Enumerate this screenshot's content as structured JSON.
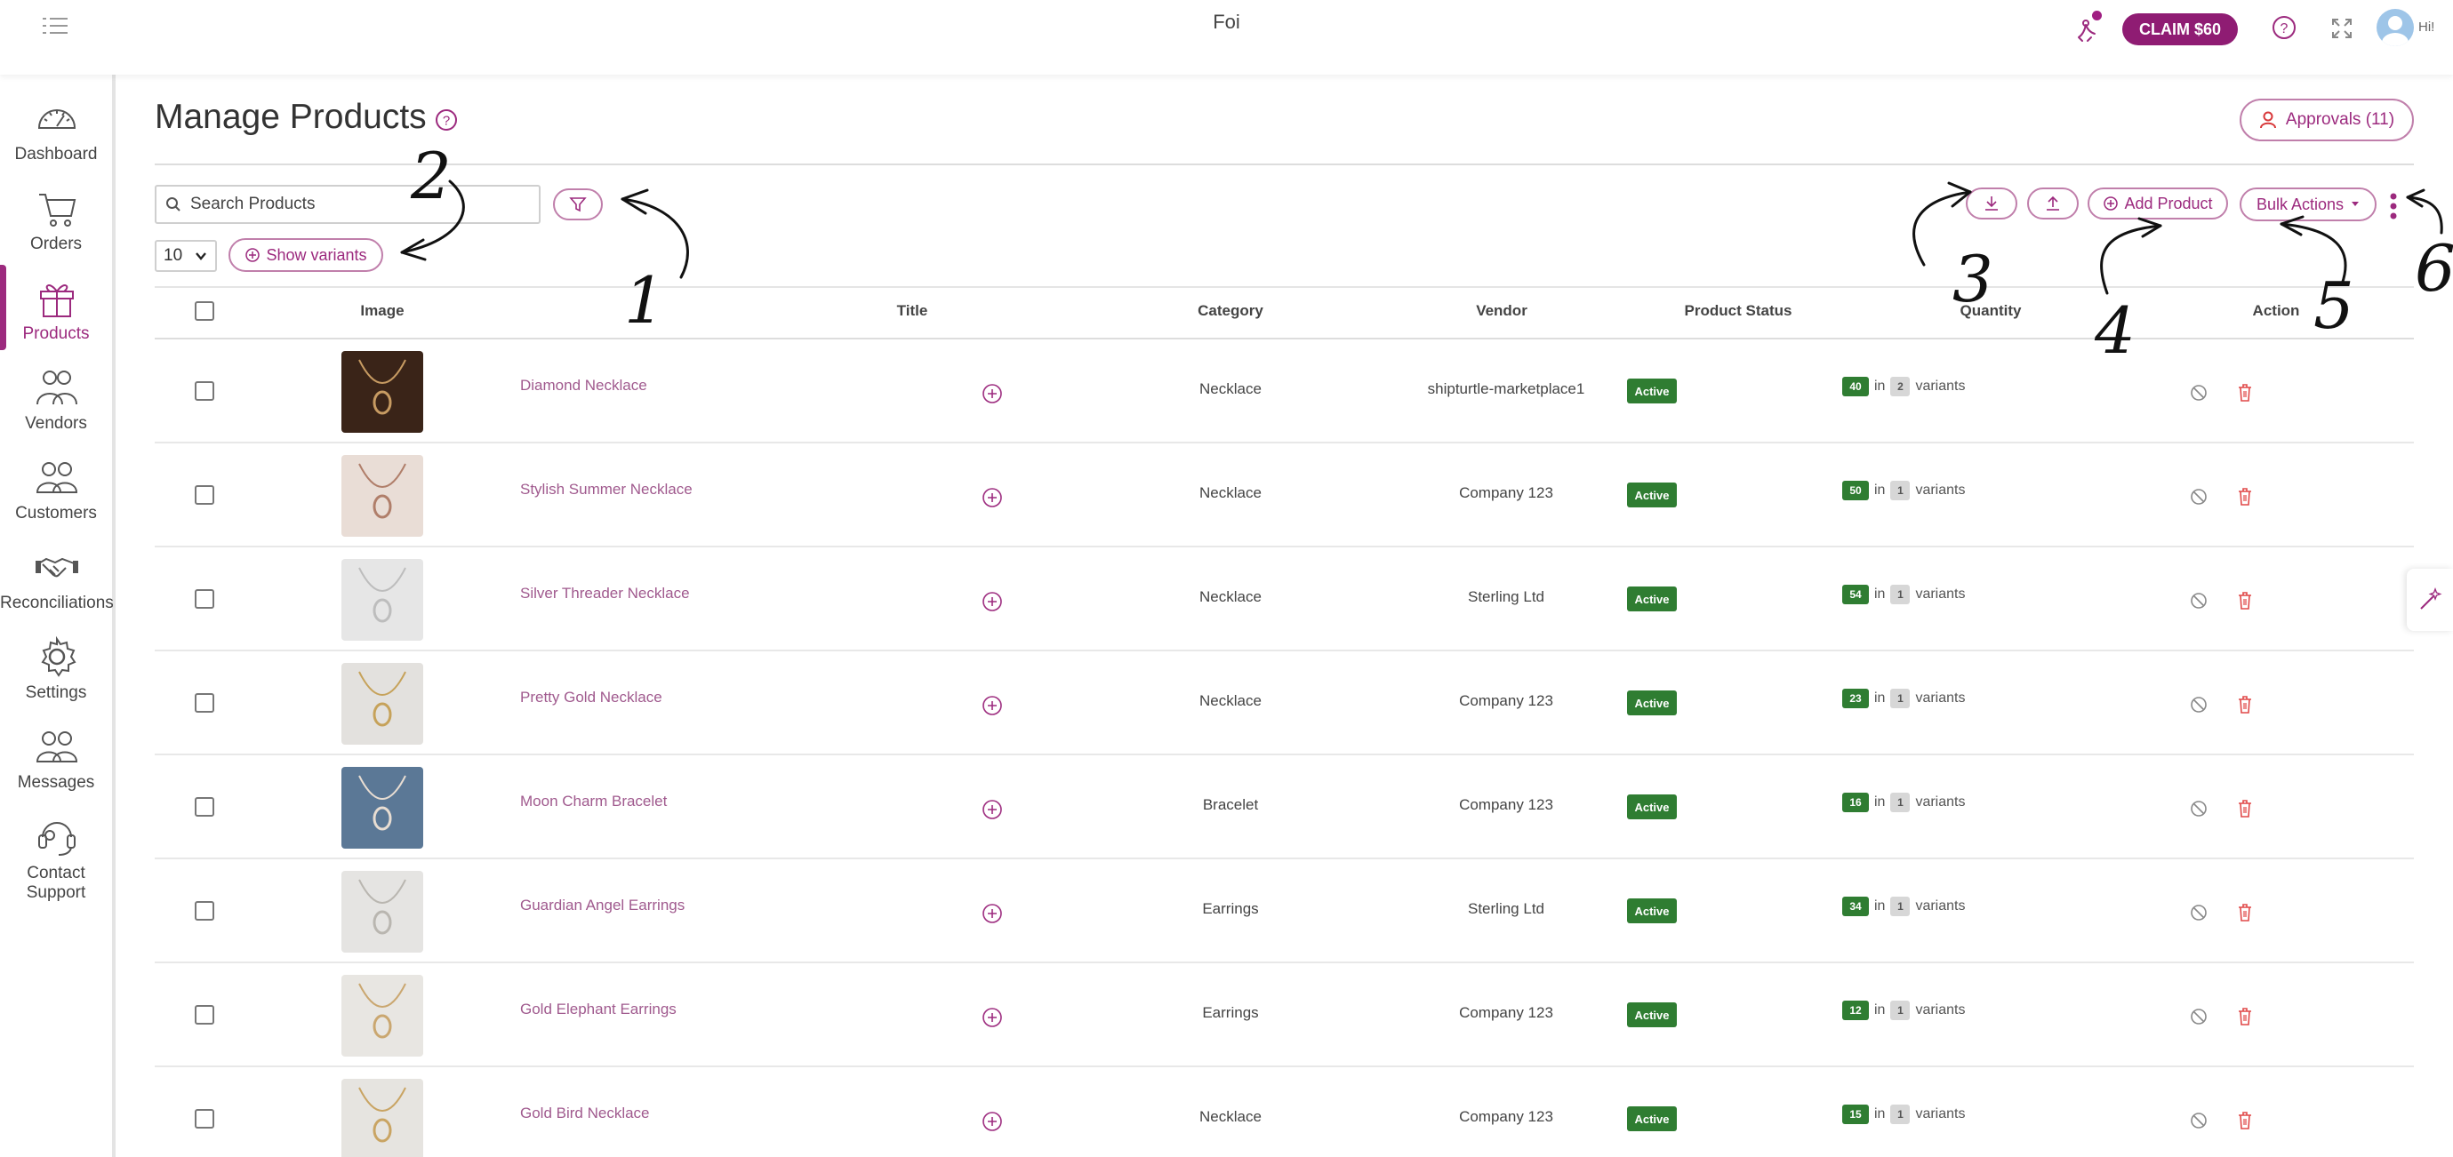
{
  "topbar": {
    "app_title": "Foi",
    "claim_label": "CLAIM $60",
    "user_greeting": "Hi!",
    "icons": [
      "menu-toggle-icon",
      "notification-icon",
      "help-icon",
      "fullscreen-icon",
      "avatar"
    ]
  },
  "sidebar": {
    "items": [
      {
        "label": "Dashboard",
        "icon": "speedometer-icon",
        "active": false
      },
      {
        "label": "Orders",
        "icon": "cart-icon",
        "active": false
      },
      {
        "label": "Products",
        "icon": "gift-icon",
        "active": true
      },
      {
        "label": "Vendors",
        "icon": "vendors-group-icon",
        "active": false
      },
      {
        "label": "Customers",
        "icon": "customers-group-icon",
        "active": false
      },
      {
        "label": "Reconciliations",
        "icon": "handshake-icon",
        "active": false
      },
      {
        "label": "Settings",
        "icon": "gear-icon",
        "active": false
      },
      {
        "label": "Messages",
        "icon": "messages-group-icon",
        "active": false
      },
      {
        "label": "Contact Support",
        "label_line1": "Contact",
        "label_line2": "Support",
        "icon": "headset-icon",
        "active": false
      }
    ]
  },
  "page": {
    "title": "Manage Products",
    "approvals_label": "Approvals (11)"
  },
  "toolbar": {
    "search_placeholder": "Search Products",
    "page_size": "10",
    "show_variants_label": "Show variants",
    "add_product_label": "Add Product",
    "bulk_actions_label": "Bulk Actions"
  },
  "table": {
    "columns": {
      "image": "Image",
      "title": "Title",
      "category": "Category",
      "vendor": "Vendor",
      "status": "Product Status",
      "quantity": "Quantity",
      "action": "Action"
    },
    "in_word": "in",
    "variants_word": "variants",
    "rows": [
      {
        "title": "Diamond Necklace",
        "category": "Necklace",
        "vendor": "shipturtle-marketplace1",
        "status": "Active",
        "quantity": "40",
        "variants": "2",
        "thumb_bg": "#3a2418",
        "thumb_fg": "#c79b62"
      },
      {
        "title": "Stylish Summer Necklace",
        "category": "Necklace",
        "vendor": "Company 123",
        "status": "Active",
        "quantity": "50",
        "variants": "1",
        "thumb_bg": "#e9ddd6",
        "thumb_fg": "#b07e6a"
      },
      {
        "title": "Silver Threader Necklace",
        "category": "Necklace",
        "vendor": "Sterling Ltd",
        "status": "Active",
        "quantity": "54",
        "variants": "1",
        "thumb_bg": "#e6e6e6",
        "thumb_fg": "#bdbdbd"
      },
      {
        "title": "Pretty Gold Necklace",
        "category": "Necklace",
        "vendor": "Company 123",
        "status": "Active",
        "quantity": "23",
        "variants": "1",
        "thumb_bg": "#e3e1de",
        "thumb_fg": "#c6a25a"
      },
      {
        "title": "Moon Charm Bracelet",
        "category": "Bracelet",
        "vendor": "Company 123",
        "status": "Active",
        "quantity": "16",
        "variants": "1",
        "thumb_bg": "#5b7896",
        "thumb_fg": "#e8ddd2"
      },
      {
        "title": "Guardian Angel Earrings",
        "category": "Earrings",
        "vendor": "Sterling Ltd",
        "status": "Active",
        "quantity": "34",
        "variants": "1",
        "thumb_bg": "#e5e4e2",
        "thumb_fg": "#b9b6b0"
      },
      {
        "title": "Gold Elephant Earrings",
        "category": "Earrings",
        "vendor": "Company 123",
        "status": "Active",
        "quantity": "12",
        "variants": "1",
        "thumb_bg": "#e8e6e2",
        "thumb_fg": "#caa770"
      },
      {
        "title": "Gold Bird Necklace",
        "category": "Necklace",
        "vendor": "Company 123",
        "status": "Active",
        "quantity": "15",
        "variants": "1",
        "thumb_bg": "#e6e4e0",
        "thumb_fg": "#c9a463"
      }
    ]
  },
  "annotations": [
    "1",
    "2",
    "3",
    "4",
    "5",
    "6"
  ],
  "colors": {
    "brand": "#8f1c73",
    "accent_text": "#9c2a7e",
    "active_badge": "#2f7d32",
    "delete_icon": "#e04848"
  }
}
